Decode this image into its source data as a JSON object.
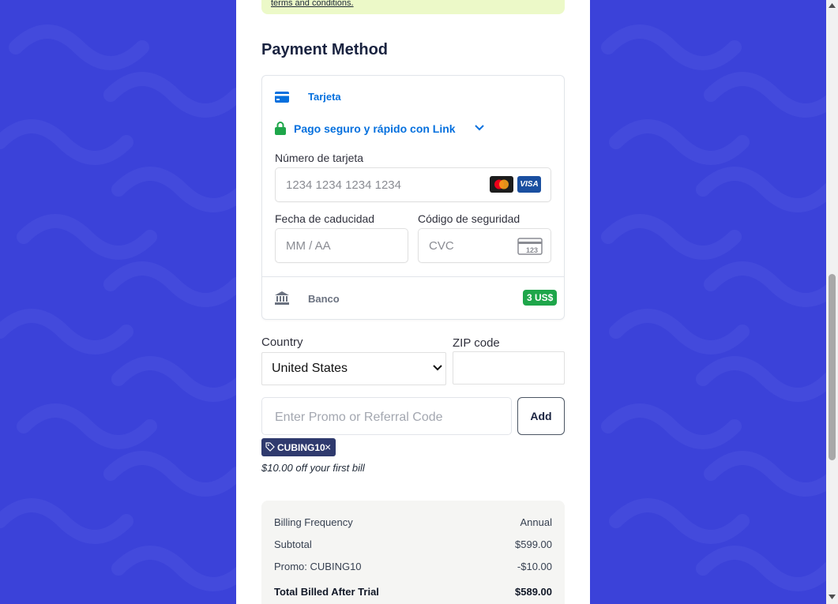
{
  "terms": {
    "text": "terms and conditions."
  },
  "payment": {
    "section_title": "Payment Method",
    "card_tab": {
      "label": "Tarjeta",
      "icon": "credit-card-icon"
    },
    "link": {
      "label": "Pago seguro y rápido con Link",
      "icon": "lock-icon"
    },
    "card_number": {
      "label": "Número de tarjeta",
      "placeholder": "1234 1234 1234 1234",
      "brands": [
        "mastercard",
        "VISA"
      ]
    },
    "expiry": {
      "label": "Fecha de caducidad",
      "placeholder": "MM / AA"
    },
    "cvc": {
      "label": "Código de seguridad",
      "placeholder": "CVC",
      "icon_text": "123"
    },
    "bank_tab": {
      "label": "Banco",
      "badge": "3 US$",
      "icon": "bank-icon"
    }
  },
  "address": {
    "country_label": "Country",
    "country_value": "United States",
    "zip_label": "ZIP code",
    "zip_value": ""
  },
  "promo": {
    "placeholder": "Enter Promo or Referral Code",
    "add_label": "Add",
    "applied_code": "CUBING10",
    "remove_symbol": "×",
    "note": "$10.00 off your first bill"
  },
  "summary": {
    "rows": [
      {
        "label": "Billing Frequency",
        "value": "Annual"
      },
      {
        "label": "Subtotal",
        "value": "$599.00"
      },
      {
        "label": "Promo: CUBING10",
        "value": "-$10.00"
      }
    ],
    "total": {
      "label": "Total Billed After Trial",
      "value": "$589.00"
    }
  },
  "colors": {
    "page_background": "#3b42d9",
    "link_blue": "#0570de",
    "badge_green": "#1ea64a",
    "promo_tag": "#2f3a6e",
    "lock_green": "#1ea64a"
  }
}
